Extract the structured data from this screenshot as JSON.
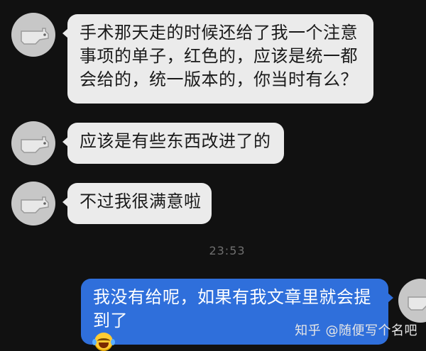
{
  "messages": [
    {
      "lines": [
        "手术那天走的时候还给了我一个注意",
        "事项的单子，红色的，应该是统一都",
        "会给的，统一版本的，你当时有么？"
      ]
    },
    {
      "lines": [
        "应该是有些东西改进了的"
      ]
    },
    {
      "lines": [
        "不过我很满意啦"
      ]
    },
    {
      "lines": [
        "我没有给呢，如果有我文章里就会提",
        "到了"
      ]
    }
  ],
  "timestamp": "23:53",
  "watermark": "知乎 @随便写个名吧",
  "colors": {
    "background": "#111111",
    "incoming_bubble": "#ebebeb",
    "outgoing_bubble": "#2f6fdb",
    "timestamp": "#6f6f6f"
  },
  "icons": {
    "avatar": "dog-avatar-icon",
    "emoji": "laughing-crying-emoji-icon"
  }
}
